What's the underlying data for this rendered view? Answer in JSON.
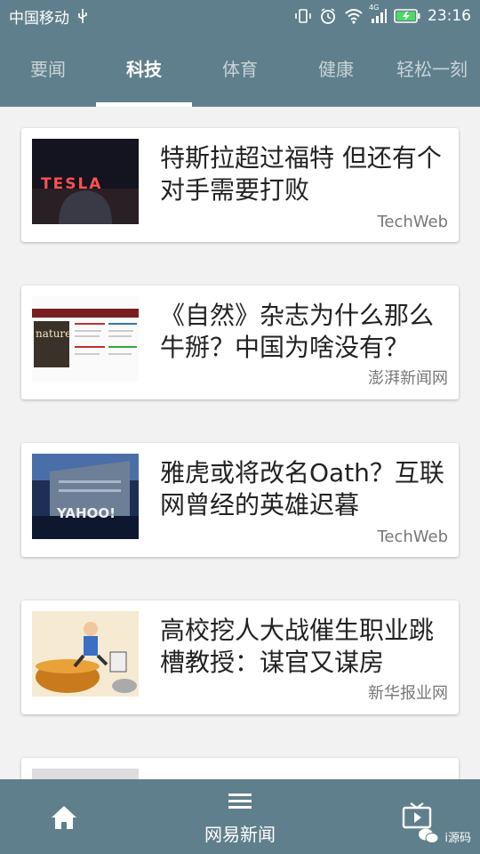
{
  "status": {
    "carrier": "中国移动",
    "time": "23:16",
    "network_badge": "4G"
  },
  "tabs": [
    {
      "label": "要闻"
    },
    {
      "label": "科技"
    },
    {
      "label": "体育"
    },
    {
      "label": "健康"
    },
    {
      "label": "轻松一刻"
    }
  ],
  "feed": [
    {
      "title": "特斯拉超过福特 但还有个对手需要打败",
      "source": "TechWeb",
      "image": "tesla-photo",
      "image_text": "TESLA"
    },
    {
      "title": "《自然》杂志为什么那么牛掰？中国为啥没有？",
      "source": "澎湃新闻网",
      "image": "nature-journal-screenshot",
      "image_text": "nature"
    },
    {
      "title": "雅虎或将改名Oath？互联网曾经的英雄迟暮",
      "source": "TechWeb",
      "image": "yahoo-building-photo",
      "image_text": "YAHOO!"
    },
    {
      "title": "高校挖人大战催生职业跳槽教授：谋官又谋房",
      "source": "新华报业网",
      "image": "cartoon-professor",
      "image_text": ""
    }
  ],
  "bottom_nav": {
    "center_label": "网易新闻",
    "watermark": "i源码"
  }
}
